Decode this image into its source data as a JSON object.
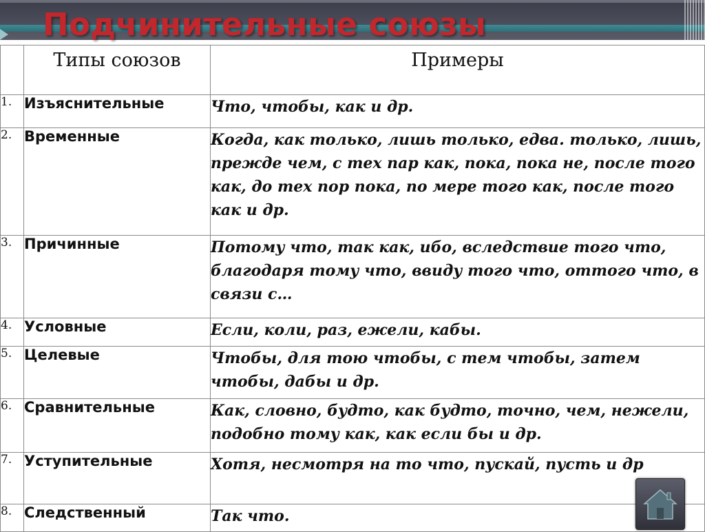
{
  "slide": {
    "title": "Подчинительные союзы",
    "colors": {
      "title": "#c1272d",
      "banner": "#4a4c59",
      "stripe": "#3f8a95",
      "grid": "#8a8a8a"
    }
  },
  "table": {
    "headers": {
      "type": "Типы союзов",
      "examples": "Примеры"
    },
    "rows": [
      {
        "num": "1.",
        "type": "Изъяснительные",
        "examples": "Что, чтобы, как и др."
      },
      {
        "num": "2.",
        "type": "Временные",
        "examples": "Когда, как только, лишь только, едва. только, лишь, прежде чем, с тех пар как, пока, пока не, после того как, до тех пор пока, по мере того как, после того как и др."
      },
      {
        "num": "3.",
        "type": "Причинные",
        "examples": "Потому что, так как, ибо, вследствие того что, благодаря тому что, ввиду того что, оттого что, в связи с…"
      },
      {
        "num": "4.",
        "type": "Условные",
        "examples": "Если, коли, раз, ежели, кабы."
      },
      {
        "num": "5.",
        "type": "Целевые",
        "examples": "Чтобы, для тою чтобы, с тем чтобы, затем чтобы, дабы и др."
      },
      {
        "num": "6.",
        "type": "Сравнительные",
        "examples": "Как, словно, будто, как будто, точно, чем, нежели, подобно тому как, как если бы и др."
      },
      {
        "num": "7.",
        "type": "Уступительные",
        "examples": "Хотя, несмотря на то что, пускай, пусть и др"
      },
      {
        "num": "8.",
        "type": "Следственный",
        "examples": "Так что."
      }
    ]
  },
  "navigation": {
    "home_icon": "home-icon"
  }
}
